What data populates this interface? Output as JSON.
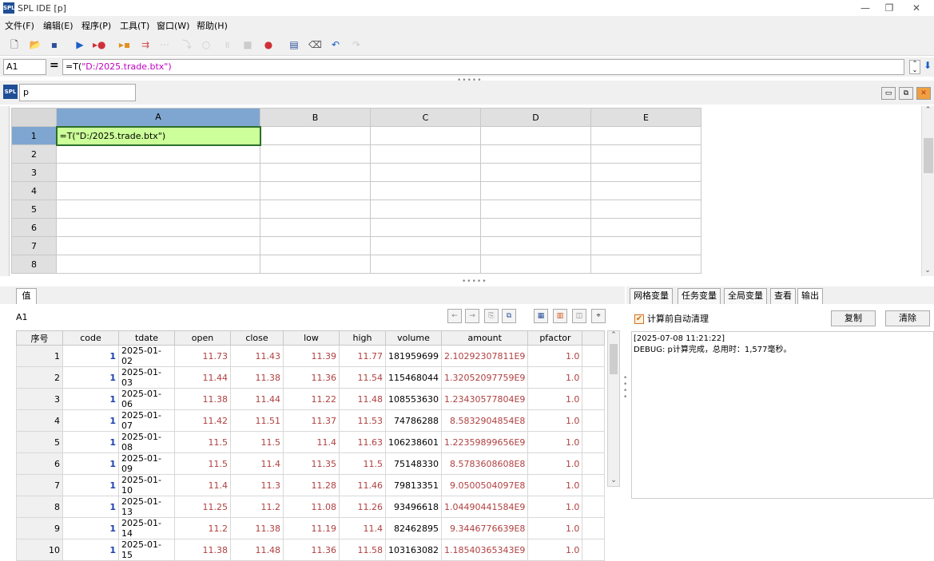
{
  "window": {
    "title": "SPL IDE  [p]",
    "logo_text": "SPL",
    "minimize_glyph": "—",
    "restore_glyph": "❐",
    "close_glyph": "✕"
  },
  "menu": [
    "文件(F)",
    "编辑(E)",
    "程序(P)",
    "工具(T)",
    "窗口(W)",
    "帮助(H)"
  ],
  "toolbar_icons": [
    "new-file-icon",
    "open-folder-icon",
    "save-icon",
    "run-icon",
    "run-to-cursor-icon",
    "step-icon",
    "debug-icon",
    "disabled-1",
    "disabled-2",
    "disabled-3",
    "pause-icon",
    "stop-icon",
    "breakpoint-icon",
    "calculator-icon",
    "eraser-icon",
    "undo-icon",
    "redo-icon"
  ],
  "formula_bar": {
    "cell_ref": "A1",
    "equals": "=",
    "formula_prefix": "=T(",
    "formula_string": "\"D:/2025.trade.btx\")"
  },
  "sheet": {
    "name": "p",
    "columns": [
      "A",
      "B",
      "C",
      "D",
      "E"
    ],
    "rows": [
      "1",
      "2",
      "3",
      "4",
      "5",
      "6",
      "7",
      "8"
    ],
    "cell_A1": "=T(\"D:/2025.trade.btx\")"
  },
  "value_panel": {
    "tab": "值",
    "cell_ref": "A1",
    "table": {
      "headers": [
        "序号",
        "code",
        "tdate",
        "open",
        "close",
        "low",
        "high",
        "volume",
        "amount",
        "pfactor"
      ],
      "rows": [
        [
          "1",
          "1",
          "2025-01-02",
          "11.73",
          "11.43",
          "11.39",
          "11.77",
          "181959699",
          "2.10292307811E9",
          "1.0"
        ],
        [
          "2",
          "1",
          "2025-01-03",
          "11.44",
          "11.38",
          "11.36",
          "11.54",
          "115468044",
          "1.32052097759E9",
          "1.0"
        ],
        [
          "3",
          "1",
          "2025-01-06",
          "11.38",
          "11.44",
          "11.22",
          "11.48",
          "108553630",
          "1.23430577804E9",
          "1.0"
        ],
        [
          "4",
          "1",
          "2025-01-07",
          "11.42",
          "11.51",
          "11.37",
          "11.53",
          "74786288",
          "8.5832904854E8",
          "1.0"
        ],
        [
          "5",
          "1",
          "2025-01-08",
          "11.5",
          "11.5",
          "11.4",
          "11.63",
          "106238601",
          "1.22359899656E9",
          "1.0"
        ],
        [
          "6",
          "1",
          "2025-01-09",
          "11.5",
          "11.4",
          "11.35",
          "11.5",
          "75148330",
          "8.5783608608E8",
          "1.0"
        ],
        [
          "7",
          "1",
          "2025-01-10",
          "11.4",
          "11.3",
          "11.28",
          "11.46",
          "79813351",
          "9.0500504097E8",
          "1.0"
        ],
        [
          "8",
          "1",
          "2025-01-13",
          "11.25",
          "11.2",
          "11.08",
          "11.26",
          "93496618",
          "1.04490441584E9",
          "1.0"
        ],
        [
          "9",
          "1",
          "2025-01-14",
          "11.2",
          "11.38",
          "11.19",
          "11.4",
          "82462895",
          "9.3446776639E8",
          "1.0"
        ],
        [
          "10",
          "1",
          "2025-01-15",
          "11.38",
          "11.48",
          "11.36",
          "11.58",
          "103163082",
          "1.18540365343E9",
          "1.0"
        ]
      ]
    }
  },
  "right_panel": {
    "tabs": [
      "网格变量",
      "任务变量",
      "全局变量",
      "查看",
      "输出"
    ],
    "active_tab": "输出",
    "auto_clear_label": "计算前自动清理",
    "copy_label": "复制",
    "clear_label": "清除",
    "output_lines": [
      "[2025-07-08 11:21:22]",
      "DEBUG: p计算完成，总用时：1,577毫秒。"
    ]
  },
  "colors": {
    "accent": "#7fa6d0",
    "cell_selected": "#ccff99",
    "string_literal": "#c000c0",
    "value_red": "#b04040"
  }
}
